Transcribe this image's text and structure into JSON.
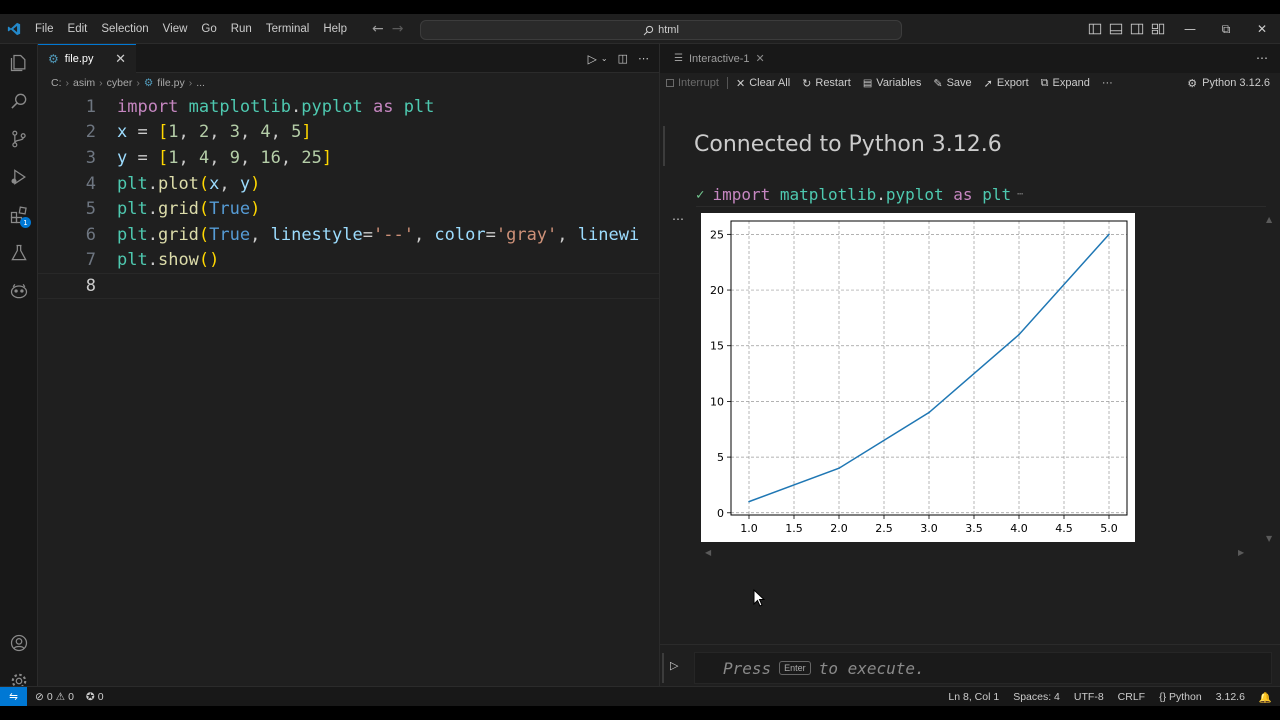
{
  "menu": [
    "File",
    "Edit",
    "Selection",
    "View",
    "Go",
    "Run",
    "Terminal",
    "Help"
  ],
  "command_center": {
    "text": "html"
  },
  "editor": {
    "tab_label": "file.py",
    "breadcrumb": [
      "C:",
      "asim",
      "cyber",
      "file.py",
      "..."
    ],
    "line_numbers": [
      "1",
      "2",
      "3",
      "4",
      "5",
      "6",
      "7",
      "8"
    ],
    "lines": [
      "import matplotlib.pyplot as plt",
      "x = [1, 2, 3, 4, 5]",
      "y = [1, 4, 9, 16, 25]",
      "plt.plot(x, y)",
      "plt.grid(True)",
      "plt.grid(True, linestyle='--', color='gray', linewi",
      "plt.show()",
      ""
    ]
  },
  "interactive": {
    "tab_label": "Interactive-1",
    "toolbar": {
      "interrupt": "Interrupt",
      "clear_all": "Clear All",
      "restart": "Restart",
      "variables": "Variables",
      "save": "Save",
      "export": "Export",
      "expand": "Expand",
      "more": "···",
      "kernel": "Python 3.12.6"
    },
    "connected": "Connected to Python 3.12.6",
    "cell_code": "import matplotlib.pyplot as plt",
    "input_prefix": "Press",
    "input_key": "Enter",
    "input_suffix": "to execute."
  },
  "chart_data": {
    "type": "line",
    "x": [
      1,
      2,
      3,
      4,
      5
    ],
    "series": [
      {
        "values": [
          1,
          4,
          9,
          16,
          25
        ],
        "color": "#1f77b4"
      }
    ],
    "xticks": [
      "1.0",
      "1.5",
      "2.0",
      "2.5",
      "3.0",
      "3.5",
      "4.0",
      "4.5",
      "5.0"
    ],
    "yticks": [
      "0",
      "5",
      "10",
      "15",
      "20",
      "25"
    ],
    "xlim": [
      0.8,
      5.2
    ],
    "ylim": [
      -0.2,
      26.2
    ],
    "grid": true,
    "title": "",
    "xlabel": "",
    "ylabel": ""
  },
  "status": {
    "errors": "0",
    "warnings": "0",
    "ports": "0",
    "position": "Ln 8, Col 1",
    "spaces": "Spaces: 4",
    "encoding": "UTF-8",
    "eol": "CRLF",
    "language": "Python",
    "version": "3.12.6"
  },
  "colors": {
    "accent": "#0078d4",
    "background": "#1f1f1f",
    "line_color": "#1f77b4"
  }
}
